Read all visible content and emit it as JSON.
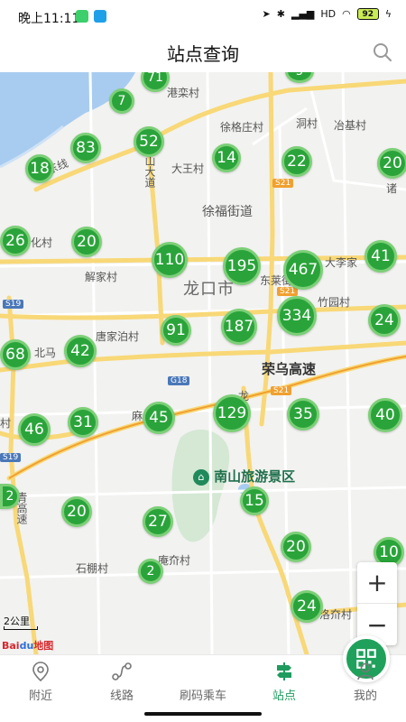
{
  "status_bar": {
    "time": "晚上11:11",
    "network": "HD",
    "battery": "92"
  },
  "header": {
    "title": "站点查询"
  },
  "map": {
    "places": [
      "港栾村",
      "徐格庄村",
      "洞村",
      "冶基村",
      "大王村",
      "徐福街道",
      "诸",
      "化村",
      "解家村",
      "龙口市",
      "东莱街",
      "大李家",
      "竹园村",
      "唐家泊村",
      "北马",
      "麻",
      "石棚村",
      "庵夼村",
      "洛夼村",
      "村"
    ],
    "roads": [
      "丹东线",
      "山大道",
      "荣乌高速",
      "青高速",
      "龙"
    ],
    "highway_signs": [
      "S19",
      "G18",
      "S21",
      "S21",
      "S21",
      "S19"
    ],
    "scenic": "南山旅游景区",
    "scale": "2公里",
    "logo": {
      "a": "Bai",
      "b": "du",
      "c": "地图"
    },
    "clusters": [
      "71",
      "7",
      "83",
      "52",
      "18",
      "14",
      "22",
      "20",
      "26",
      "20",
      "110",
      "195",
      "467",
      "41",
      "68",
      "42",
      "91",
      "187",
      "334",
      "24",
      "46",
      "31",
      "45",
      "129",
      "35",
      "40",
      "2",
      "20",
      "27",
      "15",
      "20",
      "2",
      "24",
      "10",
      "5"
    ]
  },
  "zoom": {
    "in": "+",
    "out": "−"
  },
  "bottom_nav": [
    {
      "label": "附近"
    },
    {
      "label": "线路"
    },
    {
      "label": "刷码乘车"
    },
    {
      "label": "站点"
    },
    {
      "label": "我的"
    }
  ],
  "colors": {
    "accent": "#1e9b5f",
    "cluster": "#2aa43a",
    "water": "#a8ccf0",
    "road_major": "#f8d877"
  }
}
